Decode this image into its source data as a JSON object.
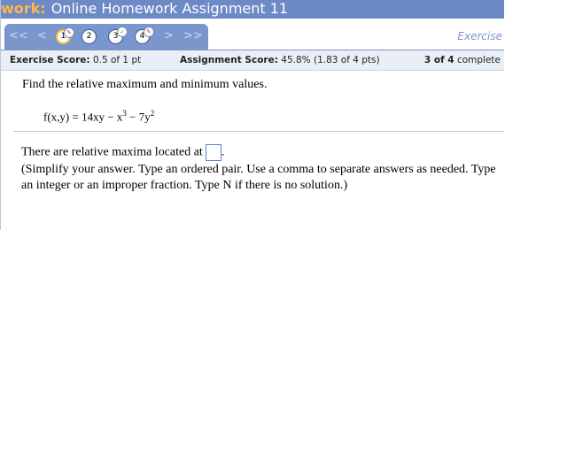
{
  "header": {
    "prefix": "work:",
    "title": "Online Homework Assignment 11"
  },
  "nav": {
    "first": "<<",
    "prev": "<",
    "next": ">",
    "last": ">>",
    "questions": [
      {
        "number": "1",
        "state": "current-partial"
      },
      {
        "number": "2",
        "state": "unanswered"
      },
      {
        "number": "3",
        "state": "correct"
      },
      {
        "number": "4",
        "state": "partial"
      }
    ],
    "exercise_label": "Exercise"
  },
  "scores": {
    "exercise_label": "Exercise Score:",
    "exercise_value": "0.5 of 1 pt",
    "assignment_label": "Assignment Score:",
    "assignment_value": "45.8% (1.83 of 4 pts)",
    "progress_bold": "3 of 4",
    "progress_rest": "complete"
  },
  "question": {
    "prompt": "Find the relative maximum and minimum values.",
    "formula_lhs": "f(x,y) = 14xy − x",
    "exp1": "3",
    "formula_mid": " − 7y",
    "exp2": "2",
    "answer_text": "There are relative maxima located at",
    "answer_suffix": ".",
    "answer_value": "",
    "instructions": "(Simplify your answer. Type an ordered pair. Use a comma to separate answers as needed. Type an integer or an improper fraction. Type N if there is no solution.)"
  }
}
